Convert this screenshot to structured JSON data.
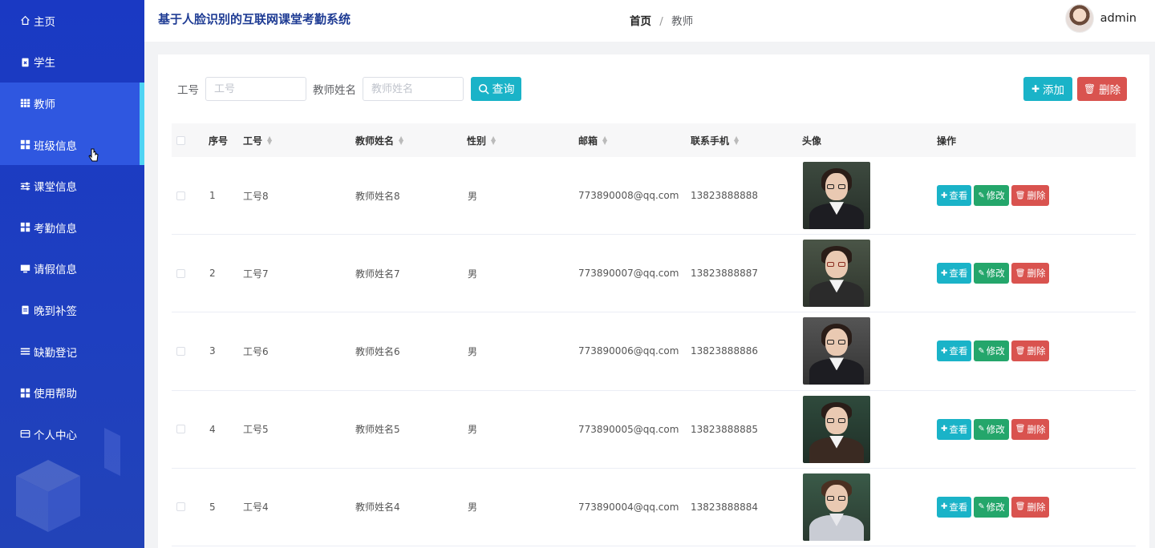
{
  "app_title": "基于人脸识别的互联网课堂考勤系统",
  "breadcrumb": {
    "home": "首页",
    "separator": "/",
    "current": "教师"
  },
  "user": {
    "name": "admin"
  },
  "sidebar": {
    "items": [
      {
        "label": "主页",
        "icon": "home-icon"
      },
      {
        "label": "学生",
        "icon": "clipboard-x-icon"
      },
      {
        "label": "教师",
        "icon": "grid-icon",
        "active": true
      },
      {
        "label": "班级信息",
        "icon": "grid-icon"
      },
      {
        "label": "课堂信息",
        "icon": "sliders-icon"
      },
      {
        "label": "考勤信息",
        "icon": "grid-icon"
      },
      {
        "label": "请假信息",
        "icon": "monitor-icon"
      },
      {
        "label": "晚到补签",
        "icon": "clipboard-icon"
      },
      {
        "label": "缺勤登记",
        "icon": "list-icon"
      },
      {
        "label": "使用帮助",
        "icon": "grid-icon"
      },
      {
        "label": "个人中心",
        "icon": "card-icon"
      }
    ]
  },
  "search": {
    "id_label": "工号",
    "id_placeholder": "工号",
    "name_label": "教师姓名",
    "name_placeholder": "教师姓名",
    "query_label": "查询"
  },
  "toolbar": {
    "add_label": "添加",
    "delete_label": "删除"
  },
  "table": {
    "headers": {
      "index": "序号",
      "id": "工号",
      "name": "教师姓名",
      "gender": "性别",
      "email": "邮箱",
      "phone": "联系手机",
      "avatar": "头像",
      "ops": "操作"
    },
    "rows": [
      {
        "index": "1",
        "id": "工号8",
        "name": "教师姓名8",
        "gender": "男",
        "email": "773890008@qq.com",
        "phone": "13823888888"
      },
      {
        "index": "2",
        "id": "工号7",
        "name": "教师姓名7",
        "gender": "男",
        "email": "773890007@qq.com",
        "phone": "13823888887"
      },
      {
        "index": "3",
        "id": "工号6",
        "name": "教师姓名6",
        "gender": "男",
        "email": "773890006@qq.com",
        "phone": "13823888886"
      },
      {
        "index": "4",
        "id": "工号5",
        "name": "教师姓名5",
        "gender": "男",
        "email": "773890005@qq.com",
        "phone": "13823888885"
      },
      {
        "index": "5",
        "id": "工号4",
        "name": "教师姓名4",
        "gender": "男",
        "email": "773890004@qq.com",
        "phone": "13823888884"
      }
    ],
    "row_actions": {
      "view": "查看",
      "edit": "修改",
      "delete": "删除"
    }
  },
  "colors": {
    "sidebar": "#1a39c3",
    "accent": "#1ab3c8",
    "edit": "#24a66b",
    "danger": "#d9534f",
    "title": "#1f3c94"
  }
}
